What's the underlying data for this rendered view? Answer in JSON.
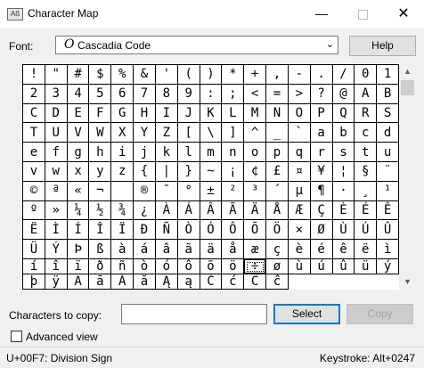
{
  "window": {
    "title": "Character Map"
  },
  "font": {
    "label": "Font:",
    "selected": "Cascadia Code"
  },
  "buttons": {
    "help": "Help",
    "select": "Select",
    "copy": "Copy"
  },
  "characters": [
    "!",
    "\"",
    "#",
    "$",
    "%",
    "&",
    "'",
    "(",
    ")",
    "*",
    "+",
    ",",
    "-",
    ".",
    "/",
    "0",
    "1",
    "2",
    "3",
    "4",
    "5",
    "6",
    "7",
    "8",
    "9",
    ":",
    ";",
    "<",
    "=",
    ">",
    "?",
    "@",
    "A",
    "B",
    "C",
    "D",
    "E",
    "F",
    "G",
    "H",
    "I",
    "J",
    "K",
    "L",
    "M",
    "N",
    "O",
    "P",
    "Q",
    "R",
    "S",
    "T",
    "U",
    "V",
    "W",
    "X",
    "Y",
    "Z",
    "[",
    "\\",
    "]",
    "^",
    "_",
    "`",
    "a",
    "b",
    "c",
    "d",
    "e",
    "f",
    "g",
    "h",
    "i",
    "j",
    "k",
    "l",
    "m",
    "n",
    "o",
    "p",
    "q",
    "r",
    "s",
    "t",
    "u",
    "v",
    "w",
    "x",
    "y",
    "z",
    "{",
    "|",
    "}",
    "~",
    "¡",
    "¢",
    "£",
    "¤",
    "¥",
    "¦",
    "§",
    "¨",
    "©",
    "ª",
    "«",
    "¬",
    "­",
    "®",
    "¯",
    "°",
    "±",
    "²",
    "³",
    "´",
    "µ",
    "¶",
    "·",
    "¸",
    "¹",
    "º",
    "»",
    "¼",
    "½",
    "¾",
    "¿",
    "À",
    "Á",
    "Â",
    "Ã",
    "Ä",
    "Å",
    "Æ",
    "Ç",
    "È",
    "É",
    "Ê",
    "Ë",
    "Ì",
    "Í",
    "Î",
    "Ï",
    "Ð",
    "Ñ",
    "Ò",
    "Ó",
    "Ô",
    "Õ",
    "Ö",
    "×",
    "Ø",
    "Ù",
    "Ú",
    "Û",
    "Ü",
    "Ý",
    "Þ",
    "ß",
    "à",
    "á",
    "â",
    "ã",
    "ä",
    "å",
    "æ",
    "ç",
    "è",
    "é",
    "ê",
    "ë",
    "ì",
    "í",
    "î",
    "ï",
    "ð",
    "ñ",
    "ò",
    "ó",
    "ô",
    "õ",
    "ö",
    "÷",
    "ø",
    "ù",
    "ú",
    "û",
    "ü",
    "ý",
    "þ",
    "ÿ",
    "Ā",
    "ā",
    "Ă",
    "ă",
    "Ą",
    "ą",
    "Ć",
    "ć",
    "Ĉ",
    "ĉ"
  ],
  "selected_character": "÷",
  "copy": {
    "label": "Characters to copy:",
    "value": ""
  },
  "advanced": {
    "label": "Advanced view",
    "checked": false
  },
  "status": {
    "left": "U+00F7: Division Sign",
    "right": "Keystroke: Alt+0247"
  }
}
